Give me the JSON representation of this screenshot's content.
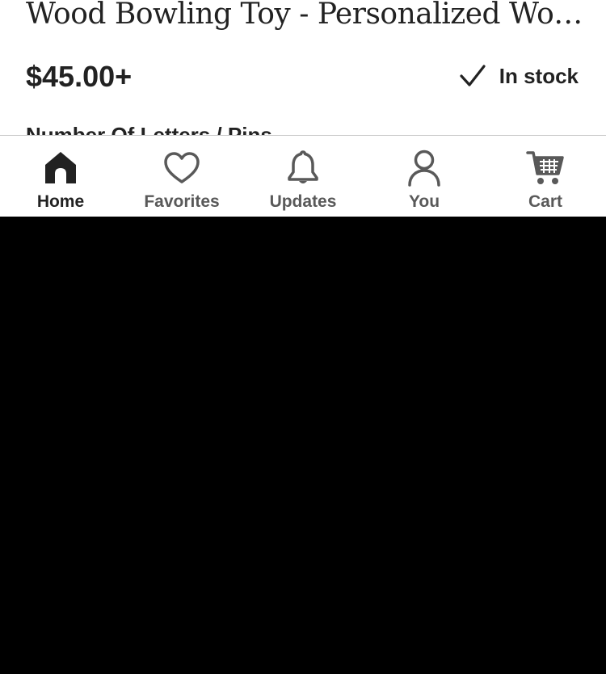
{
  "product": {
    "title": "Wood Bowling Toy - Personalized Wooden Bowling Set",
    "price": "$45.00+",
    "stock_status": "In stock",
    "option_label": "Number Of Letters / Pins"
  },
  "tabbar": {
    "active": "home",
    "tabs": [
      {
        "id": "home",
        "label": "Home",
        "icon": "home-icon"
      },
      {
        "id": "favorites",
        "label": "Favorites",
        "icon": "heart-icon"
      },
      {
        "id": "updates",
        "label": "Updates",
        "icon": "bell-icon"
      },
      {
        "id": "you",
        "label": "You",
        "icon": "person-icon"
      },
      {
        "id": "cart",
        "label": "Cart",
        "icon": "cart-icon"
      }
    ]
  },
  "colors": {
    "text": "#222222",
    "muted": "#595959",
    "divider": "#c8c8c8"
  }
}
